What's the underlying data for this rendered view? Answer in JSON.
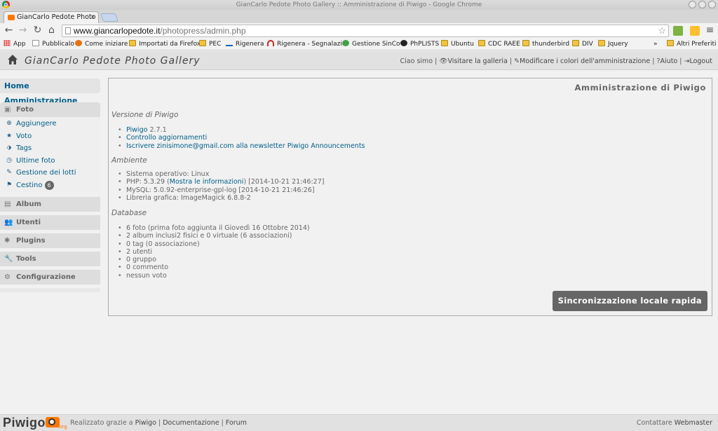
{
  "window": {
    "title": "GianCarlo Pedote Photo Gallery :: Amministrazione di Piwigo - Google Chrome"
  },
  "tab": {
    "title": "GianCarlo Pedote Photo G",
    "close": "×"
  },
  "address": {
    "domain": "www.giancarlopedote.it",
    "path": "/photopress/admin.php"
  },
  "bookmarks": {
    "items": [
      "App",
      "Pubblicalo",
      "Come iniziare",
      "Importati da Firefox",
      "PEC",
      "Rigenera",
      "Rigenera - Segnalazio",
      "Gestione SinCo",
      "PhPLISTS",
      "Ubuntu",
      "CDC RAEE",
      "thunderbird",
      "DIV",
      "Jquery"
    ],
    "more": "»",
    "other": "Altri Preferiti"
  },
  "header": {
    "title": "GianCarlo Pedote Photo Gallery",
    "greeting": "Ciao simo",
    "menu": [
      "Visitare la galleria",
      "Modificare i colori dell'amministrazione",
      "Aiuto",
      "Logout"
    ]
  },
  "sidebar": {
    "home": "Home Amministrazione",
    "foto": {
      "title": "Foto",
      "items": [
        "Aggiungere",
        "Voto",
        "Tags",
        "Ultime foto",
        "Gestione dei lotti",
        "Cestino"
      ],
      "cestino_count": "6"
    },
    "sections": [
      "Album",
      "Utenti",
      "Plugins",
      "Tools",
      "Configurazione"
    ]
  },
  "main": {
    "title": "Amministrazione di Piwigo",
    "version": {
      "heading": "Versione di Piwigo",
      "piwigo_link": "Piwigo",
      "piwigo_ver": " 2.7.1",
      "check_updates": "Controllo aggiornamenti",
      "newsletter": "Iscrivere zinisimone@gmail.com alla newsletter Piwigo Announcements"
    },
    "env": {
      "heading": "Ambiente",
      "os": "Sistema operativo: Linux",
      "php_pre": "PHP: 5.3.29 (",
      "php_link": "Mostra le informazioni",
      "php_post": ") [2014-10-21 21:46:27]",
      "mysql": "MySQL: 5.0.92-enterprise-gpl-log [2014-10-21 21:46:26]",
      "graphics": "Libreria grafica: ImageMagick 6.8.8-2"
    },
    "db": {
      "heading": "Database",
      "items": [
        "6 foto (prima foto aggiunta il Giovedì 16 Ottobre 2014)",
        "2 album inclusi2 fisici e 0 virtuale (6 associazioni)",
        "0 tag (0 associazione)",
        "2 utenti",
        "0 gruppo",
        "0 commento",
        "nessun voto"
      ]
    },
    "sync_button": "Sincronizzazione locale rapida"
  },
  "footer": {
    "logo": "Piwigo",
    "logo_tld": ".org",
    "powered": "Realizzato grazie a ",
    "powered_link": "Piwigo",
    "doc": "Documentazione",
    "forum": "Forum",
    "contact": "Contattare ",
    "webmaster": "Webmaster",
    "sep": " | "
  }
}
